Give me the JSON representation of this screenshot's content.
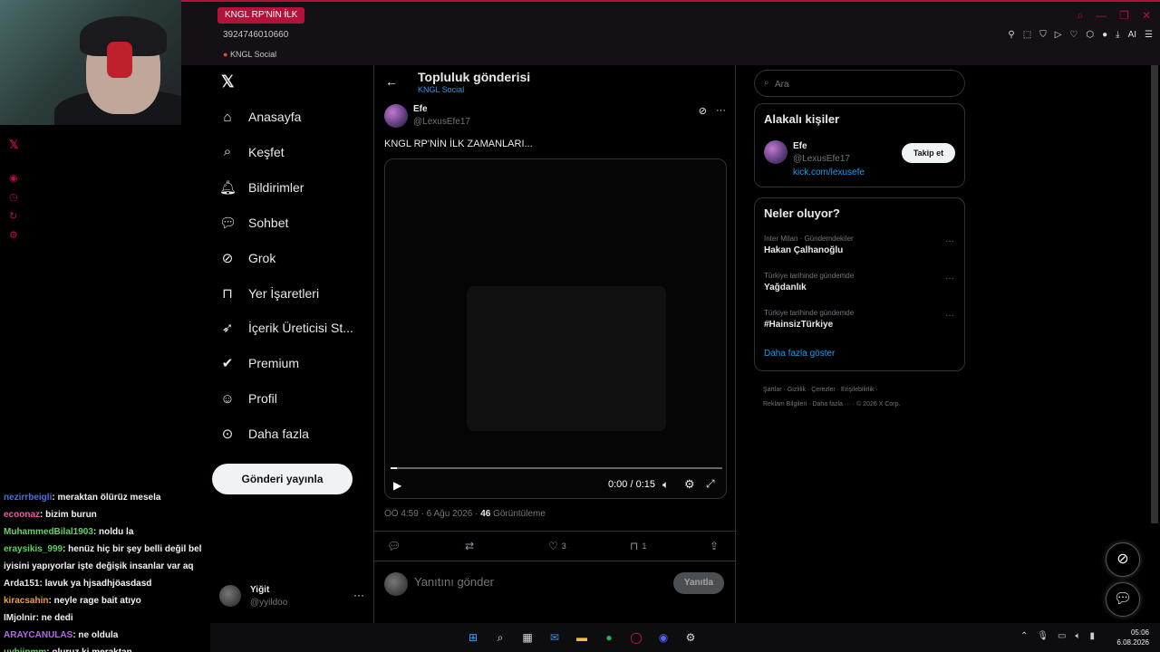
{
  "browser": {
    "tab_title": "KNGL RP'NİN İLK",
    "url_fragment": "3924746010660",
    "bookmark": "KNGL Social",
    "ai_label": "AI"
  },
  "chat": [
    {
      "user": "nezirrbeigli",
      "color": "#4a6ee0",
      "msg": ": meraktan ölürüz mesela"
    },
    {
      "user": "ecoonaz",
      "color": "#e85fa0",
      "msg": ": bizim burun"
    },
    {
      "user": "MuhammedBilal1903",
      "color": "#6ad06a",
      "msg": ": noldu la"
    },
    {
      "user": "eraysikis_999",
      "color": "#5fd15f",
      "msg": ": henüz hiç bir şey belli değil bel"
    },
    {
      "user": "",
      "color": "#f2f2f2",
      "msg": "iyisini yapıyorlar işte değişik insanlar var aq"
    },
    {
      "user": "Arda151",
      "color": "#e8e8e8",
      "msg": ": lavuk ya hjsadhjöasdasd"
    },
    {
      "user": "kiracsahin",
      "color": "#f0a030",
      "msg": ": neyle rage bait atıyo"
    },
    {
      "user": "IMjolnir",
      "color": "#e8e8e8",
      "msg": ": ne dedi"
    },
    {
      "user": "ARAYCANULAS",
      "color": "#b46ae8",
      "msg": ": ne oldula"
    },
    {
      "user": "uyhjjnmm",
      "color": "#5fd15f",
      "msg": ": oluruz ki meraktan"
    }
  ],
  "nav": {
    "items": [
      {
        "label": "Anasayfa",
        "icon": "home-icon"
      },
      {
        "label": "Keşfet",
        "icon": "search-icon"
      },
      {
        "label": "Bildirimler",
        "icon": "bell-icon"
      },
      {
        "label": "Sohbet",
        "icon": "chat-icon"
      },
      {
        "label": "Grok",
        "icon": "grok-icon"
      },
      {
        "label": "Yer İşaretleri",
        "icon": "bookmark-icon"
      },
      {
        "label": "İçerik Üreticisi St...",
        "icon": "rocket-icon"
      },
      {
        "label": "Premium",
        "icon": "verified-icon"
      },
      {
        "label": "Profil",
        "icon": "person-icon"
      },
      {
        "label": "Daha fazla",
        "icon": "more-circle-icon"
      }
    ],
    "post_button": "Gönderi yayınla",
    "me": {
      "name": "Yiğit",
      "handle": "@yyildoo"
    }
  },
  "main": {
    "title": "Topluluk gönderisi",
    "subtitle": "KNGL Social",
    "post": {
      "name": "Efe",
      "handle": "@LexusEfe17",
      "text": "KNGL RP'NİN İLK ZAMANLARI...",
      "video_time": "0:00 / 0:15",
      "video_progress": 0.02,
      "time": "ÖÖ 4:59 · 6 Ağu 2026 · ",
      "views_count": "46",
      "views_label": " Görüntüleme",
      "likes": "3",
      "bookmarks": "1"
    },
    "reply_placeholder": "Yanıtını gönder",
    "reply_button": "Yanıtla"
  },
  "right": {
    "search_placeholder": "Ara",
    "related_title": "Alakalı kişiler",
    "related": {
      "name": "Efe",
      "handle": "@LexusEfe17",
      "link": "kick.com/lexusefe",
      "follow": "Takip et"
    },
    "trending_title": "Neler oluyor?",
    "trends": [
      {
        "context": "Inter Milan · Gündemdekiler",
        "title": "Hakan Çalhanoğlu"
      },
      {
        "context": "Türkiye tarihinde gündemde",
        "title": "Yağdanlık"
      },
      {
        "context": "Türkiye tarihinde gündemde",
        "title": "#HainsizTürkiye"
      }
    ],
    "show_more": "Daha fazla göster",
    "footer_line1": "Şartlar  ·  Gizlilik  ·  Çerezler  ·  Erişilebilirlik  ·",
    "footer_line2": "Reklam Bilgileri  ·  Daha fazla ···  ·  © 2026 X Corp."
  },
  "taskbar": {
    "time": "05:06",
    "date": "6.08.2026"
  }
}
